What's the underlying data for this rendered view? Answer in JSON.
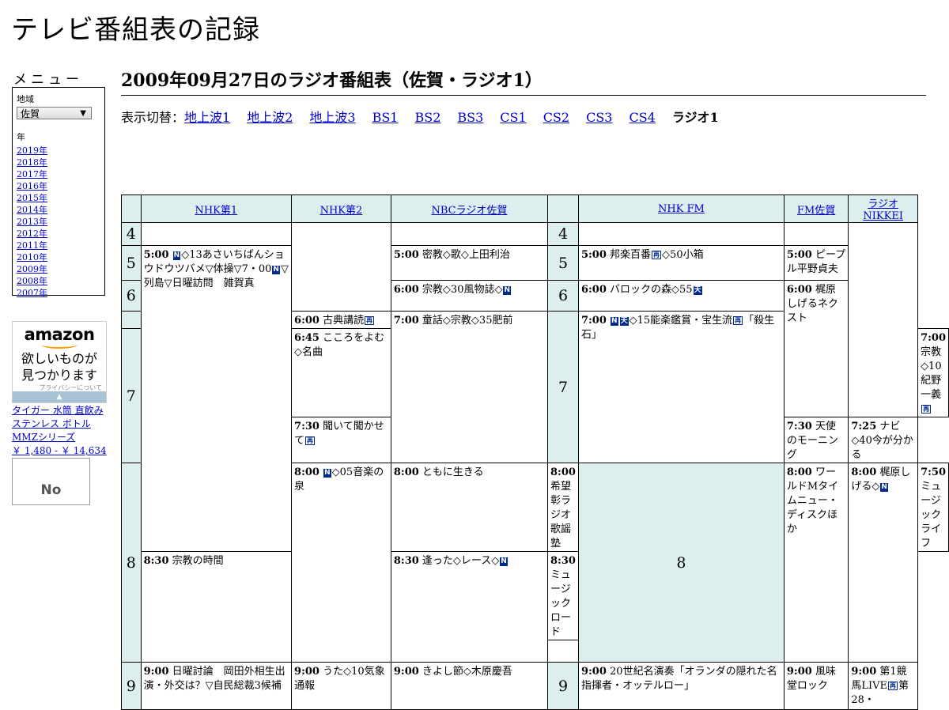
{
  "site": {
    "title": "テレビ番組表の記録"
  },
  "sidebar": {
    "menu_title": "メニュー",
    "region_label": "地域",
    "region_value": "佐賀",
    "year_label": "年",
    "years": [
      "2019年",
      "2018年",
      "2017年",
      "2016年",
      "2015年",
      "2014年",
      "2013年",
      "2012年",
      "2011年",
      "2010年",
      "2009年",
      "2008年",
      "2007年"
    ]
  },
  "ad": {
    "brand": "amazon",
    "tagline_1": "欲しいものが",
    "tagline_2": "見つかります",
    "privacy": "プライバシーについて",
    "product_text": "タイガー 水筒 直飲み ステンレス ボトル MMZシリーズ",
    "price": "￥ 1,480 - ￥ 14,634",
    "noimage": "No"
  },
  "page": {
    "heading": "2009年09月27日のラジオ番組表（佐賀・ラジオ1）",
    "switch_label": "表示切替：",
    "switch_links": [
      "地上波1",
      "地上波2",
      "地上波3",
      "BS1",
      "BS2",
      "BS3",
      "CS1",
      "CS2",
      "CS3",
      "CS4"
    ],
    "switch_current": "ラジオ1"
  },
  "guide": {
    "channels": [
      "NHK第1",
      "NHK第2",
      "NBCラジオ佐賀",
      "NHK FM",
      "FM佐賀",
      "ラジオNIKKEI"
    ],
    "hours": [
      "4",
      "5",
      "6",
      "7",
      "8",
      "9"
    ],
    "marks": {
      "news": "N",
      "stereo": "天",
      "rebroadcast": "再",
      "rebroadcast_alt": "再"
    },
    "programs": {
      "nhk1_0500": {
        "time": "5:00",
        "pre": "",
        "mark": "N",
        "title": "◇13あさいちばんショウドウツバメ▽体操▽7・00",
        "mark2": "N",
        "title2": "▽列島▽日曜訪問　雑賀真"
      },
      "nhk1_0800": {
        "time": "8:00",
        "mark": "N",
        "title": "◇05音楽の泉"
      },
      "nhk1_0900": {
        "time": "9:00",
        "title": "日曜討論　岡田外相生出演・外交は？▽自民総裁3候補"
      },
      "nhk2_0600": {
        "time": "6:00",
        "title": "古典講読",
        "mark": "再"
      },
      "nhk2_0645": {
        "time": "6:45",
        "title": "こころをよむ◇名曲"
      },
      "nhk2_0730": {
        "time": "7:30",
        "title": "聞いて聞かせて",
        "mark": "再"
      },
      "nhk2_0800": {
        "time": "8:00",
        "title": "ともに生きる"
      },
      "nhk2_0830": {
        "time": "8:30",
        "title": "宗教の時間"
      },
      "nhk2_0900": {
        "time": "9:00",
        "title": "うた◇10気象通報"
      },
      "nbc_0500": {
        "time": "5:00",
        "title": "密教◇歌◇上田利治"
      },
      "nbc_0600": {
        "time": "6:00",
        "title": "宗教◇30風物誌◇",
        "mark": "N"
      },
      "nbc_0700": {
        "time": "7:00",
        "title": "童話◇宗教◇35肥前"
      },
      "nbc_0800": {
        "time": "8:00",
        "title": "希望彰ラジオ歌謡塾"
      },
      "nbc_0830": {
        "time": "8:30",
        "title": "逢った◇レース◇",
        "mark": "N"
      },
      "nbc_0900": {
        "time": "9:00",
        "title": "きよし節◇木原慶吾"
      },
      "fm_0500": {
        "time": "5:00",
        "title": "邦楽百番",
        "mark": "再",
        "title2": "◇50小箱"
      },
      "fm_0600": {
        "time": "6:00",
        "title": "バロックの森◇55",
        "mark": "天"
      },
      "fm_0700": {
        "time": "7:00",
        "mark": "N",
        "mark2": "天",
        "title": "◇15能楽鑑賞・宝生流",
        "mark3": "再",
        "title2": "「殺生石」"
      },
      "fm_0800": {
        "time": "8:00",
        "title": "ワールドMタイムニュー・ディスクほか"
      },
      "fm_0900": {
        "time": "9:00",
        "title": "20世紀名演奏「オランダの隠れた名指揮者・オッテルロー」"
      },
      "fms_0500": {
        "time": "5:00",
        "title": "ピープル平野貞夫"
      },
      "fms_0600": {
        "time": "6:00",
        "title": "梶原しげるネクスト"
      },
      "fms_0730": {
        "time": "7:30",
        "title": "天使のモーニング"
      },
      "fms_0800": {
        "time": "8:00",
        "title": "梶原しげる◇",
        "mark": "N"
      },
      "fms_0900": {
        "time": "9:00",
        "title": "風味堂ロック"
      },
      "nk_0700": {
        "time": "7:00",
        "title": "宗教◇10紀野一義",
        "mark": "再"
      },
      "nk_0725": {
        "time": "7:25",
        "title": "ナビ◇40今が分かる"
      },
      "nk_0750": {
        "time": "7:50",
        "title": "ミュージックライフ"
      },
      "nk_0830": {
        "time": "8:30",
        "title": "ミュージックロード"
      },
      "nk_0900": {
        "time": "9:00",
        "title": "第1競馬LIVE",
        "mark": "再",
        "title2": "第28・"
      }
    }
  }
}
